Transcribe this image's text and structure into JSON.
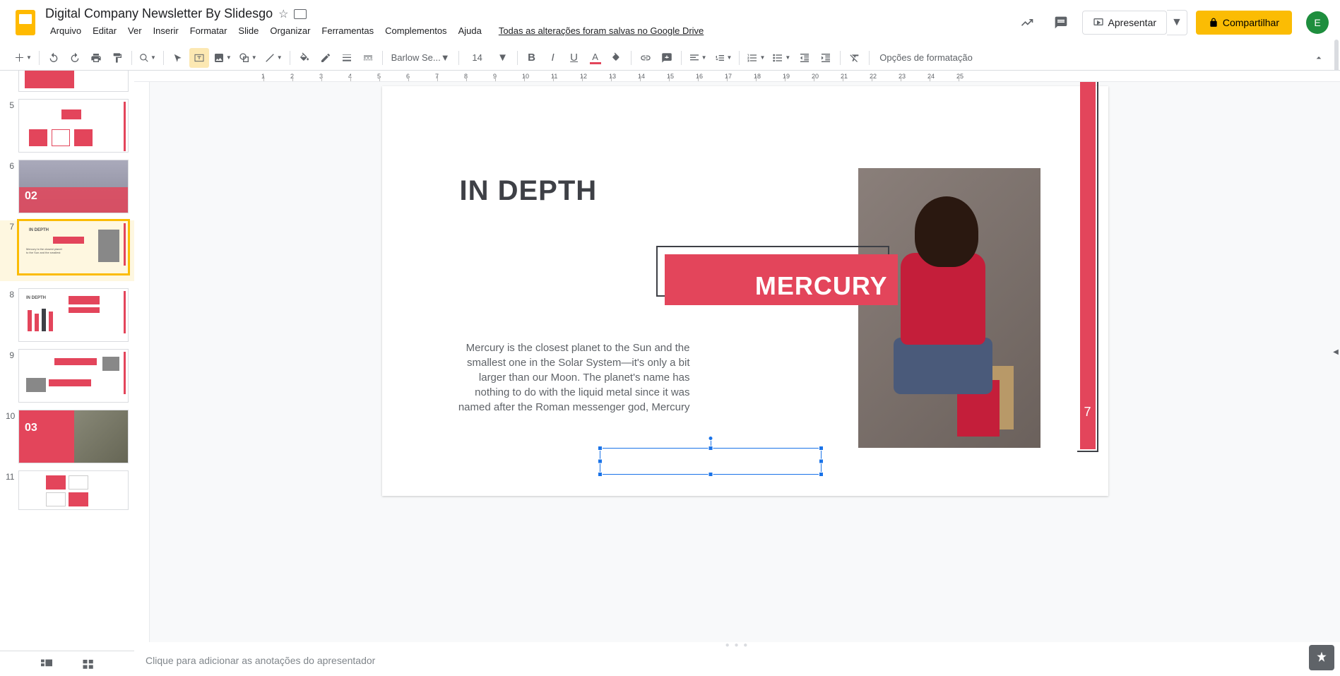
{
  "header": {
    "title": "Digital Company Newsletter By Slidesgo",
    "avatar": "E"
  },
  "menu": {
    "arquivo": "Arquivo",
    "editar": "Editar",
    "ver": "Ver",
    "inserir": "Inserir",
    "formatar": "Formatar",
    "slide": "Slide",
    "organizar": "Organizar",
    "ferramentas": "Ferramentas",
    "complementos": "Complementos",
    "ajuda": "Ajuda",
    "save_status": "Todas as alterações foram salvas no Google Drive"
  },
  "buttons": {
    "present": "Apresentar",
    "share": "Compartilhar"
  },
  "toolbar": {
    "font": "Barlow Se...",
    "size": "14",
    "format_options": "Opções de formatação"
  },
  "filmstrip": {
    "numbers": [
      "5",
      "6",
      "7",
      "8",
      "9",
      "10",
      "11"
    ],
    "selected": "7"
  },
  "slide": {
    "heading": "IN DEPTH",
    "subtitle": "MERCURY",
    "body": "Mercury is the closest planet to the Sun and the smallest one in the Solar System—it's only a bit larger than our Moon. The planet's name has nothing to do with the liquid metal since it was named after the Roman messenger god, Mercury",
    "page_num": "7"
  },
  "notes": {
    "placeholder": "Clique para adicionar as anotações do apresentador"
  },
  "ruler": {
    "h_labels": [
      "1",
      "2",
      "3",
      "4",
      "5",
      "6",
      "7",
      "8",
      "9",
      "10",
      "11",
      "12",
      "13",
      "14",
      "15",
      "16",
      "17",
      "18",
      "19",
      "20",
      "21",
      "22",
      "23",
      "24",
      "25"
    ]
  }
}
